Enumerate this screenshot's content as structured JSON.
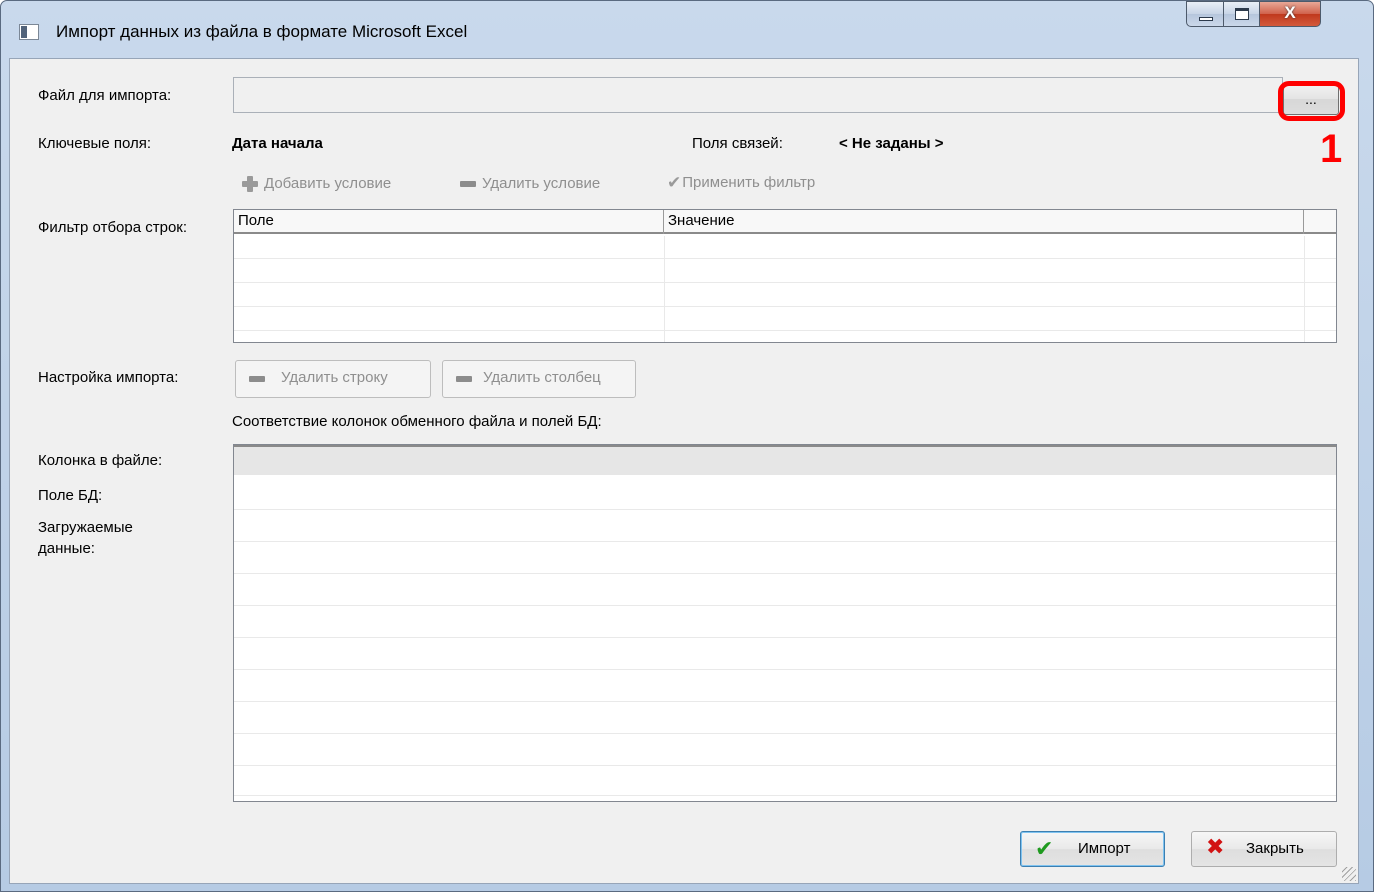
{
  "window": {
    "title": "Импорт данных из файла в формате Microsoft Excel",
    "close_glyph": "X"
  },
  "form": {
    "file_label": "Файл для импорта:",
    "file_value": "",
    "browse_label": "...",
    "annotation_number": "1",
    "key_fields_label": "Ключевые поля:",
    "key_fields_value": "Дата начала",
    "links_label": "Поля связей:",
    "links_value": "< Не заданы >"
  },
  "filter_toolbar": {
    "add_condition": "Добавить условие",
    "remove_condition": "Удалить условие",
    "apply_filter": "Применить фильтр"
  },
  "filter": {
    "label": "Фильтр отбора строк:",
    "columns": [
      "Поле",
      "Значение"
    ],
    "rows": []
  },
  "import_settings": {
    "label": "Настройка импорта:",
    "delete_row": "Удалить строку",
    "delete_column": "Удалить столбец",
    "mapping_caption": "Соответствие колонок обменного файла и полей БД:",
    "column_in_file_label": "Колонка в файле:",
    "db_field_label": "Поле БД:",
    "loaded_data_label_line1": "Загружаемые",
    "loaded_data_label_line2": "данные:"
  },
  "footer": {
    "import_button": "Импорт",
    "close_button": "Закрыть"
  },
  "colors": {
    "annotation": "#ff0000",
    "dialog_background": "#f0f0f0"
  }
}
